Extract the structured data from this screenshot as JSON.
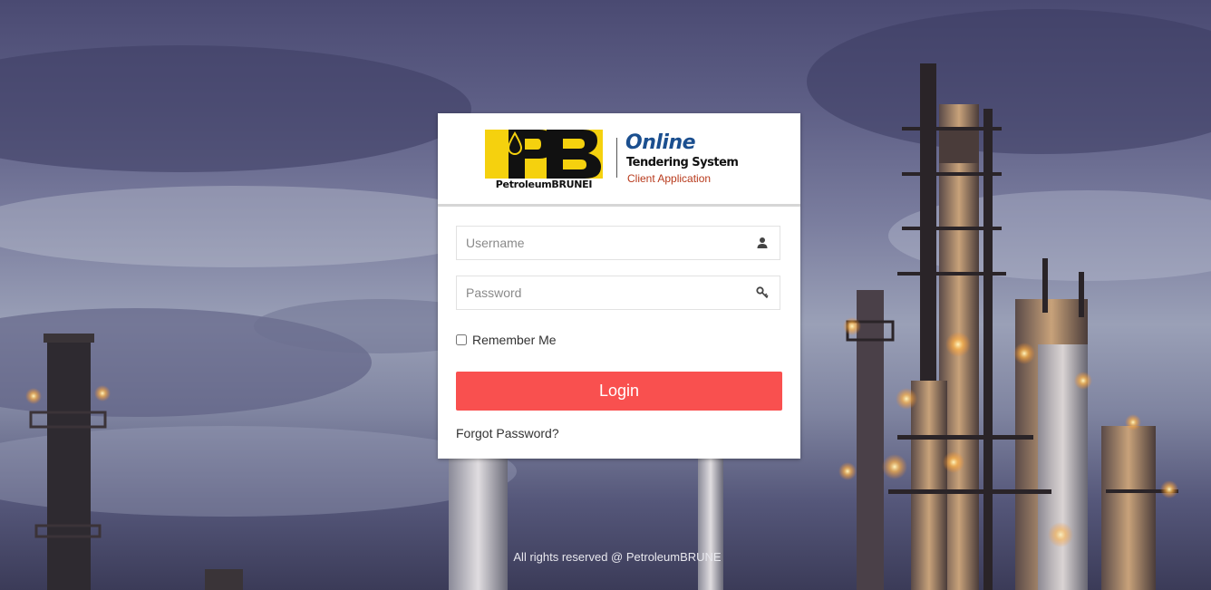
{
  "header": {
    "logo_caption": "PetroleumBRUNEI",
    "title": "Online",
    "subtitle": "Tendering System",
    "app_name": "Client Application"
  },
  "form": {
    "username_placeholder": "Username",
    "password_placeholder": "Password",
    "remember_label": "Remember Me",
    "remember_checked": false,
    "login_label": "Login",
    "forgot_label": "Forgot Password?"
  },
  "footer": {
    "text": "All rights reserved @ PetroleumBRUNE"
  },
  "icons": {
    "username_icon": "user-icon",
    "password_icon": "key-icon"
  },
  "colors": {
    "accent": "#f9504f",
    "title_blue": "#1b4f8f",
    "app_red": "#b83a1c",
    "logo_yellow": "#f5d10e"
  }
}
